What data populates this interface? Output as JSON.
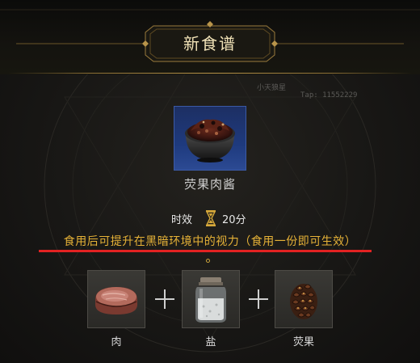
{
  "header": {
    "title": "新食谱"
  },
  "watermark": {
    "name": "小天狼星",
    "tap": "Tap: 11552229"
  },
  "recipe": {
    "icon": "meat-sauce-bowl",
    "name": "荧果肉酱",
    "time_label": "时效",
    "time_icon": "hourglass-icon",
    "time_value": "20分",
    "effect": "食用后可提升在黑暗环境中的视力（食用一份即可生效）"
  },
  "ingredients": [
    {
      "label": "肉",
      "icon": "meat-steak-icon"
    },
    {
      "label": "盐",
      "icon": "salt-jar-icon"
    },
    {
      "label": "荧果",
      "icon": "glowfruit-pinecone-icon"
    }
  ],
  "colors": {
    "effect_text": "#e6b237",
    "highlight_underline": "#e22222",
    "rarity_blue": "#1e3a7e",
    "title_text": "#f2e3b8"
  }
}
